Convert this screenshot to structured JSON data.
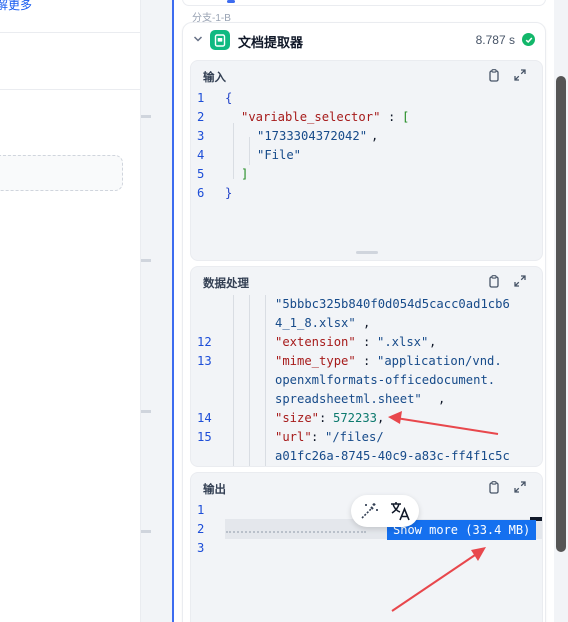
{
  "left_pane": {
    "learn_more": "解更多"
  },
  "panel": {
    "branch_label": "分支-1-B",
    "node": {
      "title": "文档提取器",
      "time": "8.787 s",
      "icon": "document-extractor-icon",
      "status": "success"
    },
    "sections": {
      "input": {
        "title": "输入",
        "lines": [
          {
            "n": "1",
            "text": "{"
          },
          {
            "n": "2",
            "key": "\"variable_selector\"",
            "rest": ": ["
          },
          {
            "n": "3",
            "str": "\"1733304372042\"",
            "rest": ","
          },
          {
            "n": "4",
            "str": "\"File\""
          },
          {
            "n": "5",
            "text": "]"
          },
          {
            "n": "6",
            "text": "}"
          }
        ]
      },
      "process": {
        "title": "数据处理",
        "lines": [
          {
            "n": "",
            "str": "\"5bbbc325b840f0d054d5cacc0ad1cb6"
          },
          {
            "n": "",
            "str": "4_1_8.xlsx\"",
            "rest": ","
          },
          {
            "n": "12",
            "key": "\"extension\"",
            "rest": ": ",
            "str": "\".xlsx\"",
            "rest2": ","
          },
          {
            "n": "13",
            "key": "\"mime_type\"",
            "rest": ": ",
            "str": "\"application/vnd."
          },
          {
            "n": "",
            "str": "openxmlformats-officedocument."
          },
          {
            "n": "",
            "str": "spreadsheetml.sheet\"",
            "rest": ","
          },
          {
            "n": "14",
            "key": "\"size\"",
            "rest": ": ",
            "num": "572233",
            "rest2": ","
          },
          {
            "n": "15",
            "key": "\"url\"",
            "rest": ": ",
            "str": "\"/files/"
          },
          {
            "n": "",
            "str": "a01fc26a-8745-40c9-a83c-ff4f1c5c"
          }
        ]
      },
      "output": {
        "title": "输出",
        "line_numbers": [
          "1",
          "2",
          "3"
        ],
        "show_more": "Show more (33.4 MB)"
      }
    }
  },
  "colors": {
    "accent": "#3d6cf0",
    "success": "#12b76a",
    "annotation": "#e8474c",
    "show_more_bg": "#1570ef"
  }
}
